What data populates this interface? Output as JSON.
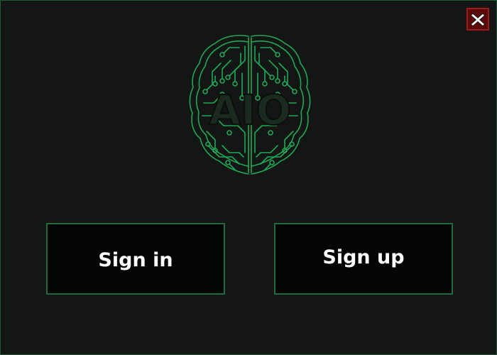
{
  "window": {
    "close_icon": "close-x-icon"
  },
  "logo": {
    "text": "AIO",
    "icon": "circuit-brain-icon"
  },
  "buttons": {
    "sign_in": "Sign in",
    "sign_up": "Sign up"
  },
  "colors": {
    "background": "#141515",
    "accent_green": "#1fa855",
    "button_fill": "#030404",
    "button_border": "#1f6a3c",
    "close_red": "#a01818"
  }
}
